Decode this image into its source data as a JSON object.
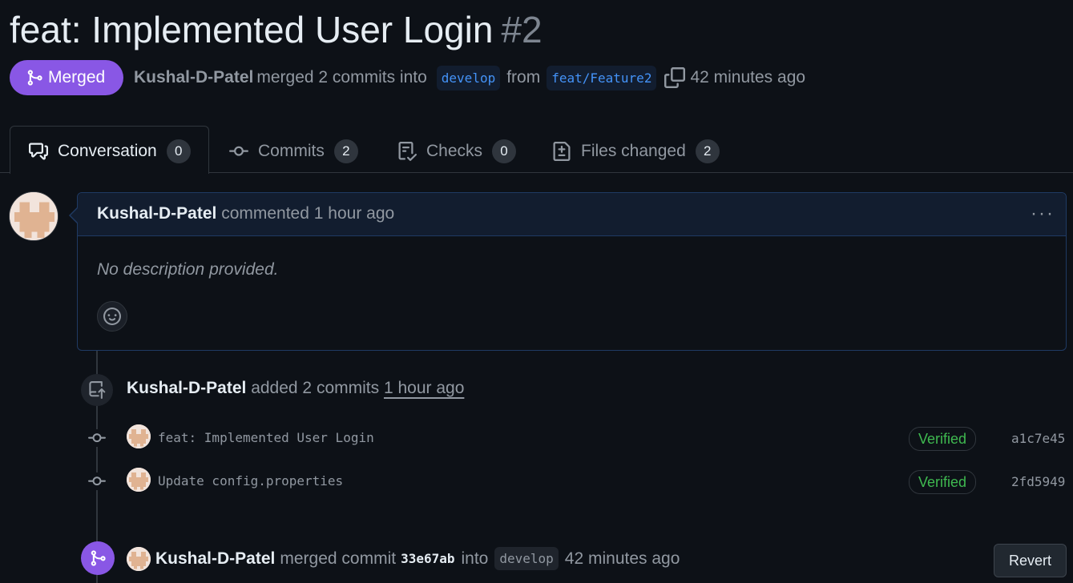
{
  "pr": {
    "title": "feat: Implemented User Login",
    "number": "#2",
    "status_label": "Merged",
    "author": "Kushal-D-Patel",
    "merged_text": "merged 2 commits into",
    "base_branch": "develop",
    "from_text": "from",
    "head_branch": "feat/Feature2",
    "merged_time": "42 minutes ago"
  },
  "tabs": [
    {
      "label": "Conversation",
      "count": "0",
      "icon": "comment-discussion-icon"
    },
    {
      "label": "Commits",
      "count": "2",
      "icon": "git-commit-icon"
    },
    {
      "label": "Checks",
      "count": "0",
      "icon": "checklist-icon"
    },
    {
      "label": "Files changed",
      "count": "2",
      "icon": "file-diff-icon"
    }
  ],
  "comment": {
    "author": "Kushal-D-Patel",
    "action": "commented",
    "time": "1 hour ago",
    "body": "No description provided.",
    "menu": "···"
  },
  "push_event": {
    "author": "Kushal-D-Patel",
    "action": "added 2 commits",
    "time": "1 hour ago"
  },
  "commits": [
    {
      "message": "feat: Implemented User Login",
      "badge": "Verified",
      "sha": "a1c7e45"
    },
    {
      "message": "Update config.properties",
      "badge": "Verified",
      "sha": "2fd5949"
    }
  ],
  "merge_event": {
    "author": "Kushal-D-Patel",
    "action": "merged commit",
    "sha": "33e67ab",
    "into_text": "into",
    "branch": "develop",
    "time": "42 minutes ago",
    "revert_label": "Revert"
  },
  "colors": {
    "background": "#0d1117",
    "merged_purple": "#8957e5",
    "link_blue": "#4493f8",
    "verified_green": "#3fb950"
  }
}
